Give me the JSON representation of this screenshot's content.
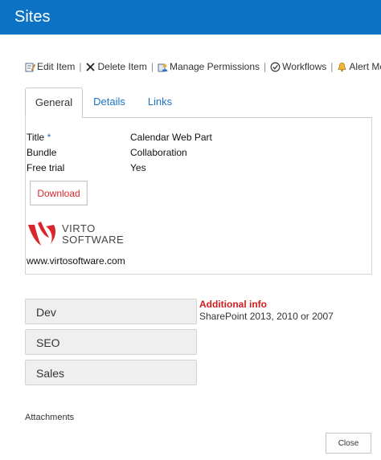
{
  "window": {
    "title": "Sites"
  },
  "toolbar": {
    "edit_item": "Edit Item",
    "delete_item": "Delete Item",
    "manage_permissions": "Manage Permissions",
    "workflows": "Workflows",
    "alert_me": "Alert Me",
    "separator": "|"
  },
  "tabs": [
    {
      "label": "General",
      "active": true
    },
    {
      "label": "Details",
      "active": false
    },
    {
      "label": "Links",
      "active": false
    }
  ],
  "fields": [
    {
      "label": "Title",
      "required_marker": " *",
      "value": "Calendar Web Part"
    },
    {
      "label": "Bundle",
      "value": "Collaboration"
    },
    {
      "label": "Free trial",
      "value": "Yes"
    }
  ],
  "download_label": "Download",
  "logo": {
    "line1": "VIRTO",
    "line2": "SOFTWARE",
    "url": "www.virtosoftware.com"
  },
  "accordion": [
    {
      "label": "Dev"
    },
    {
      "label": "SEO"
    },
    {
      "label": "Sales"
    }
  ],
  "additional_info": {
    "title": "Additional info",
    "text": "SharePoint 2013, 2010 or 2007"
  },
  "attachments_label": "Attachments",
  "close_label": "Close",
  "colors": {
    "brand_blue": "#0b72c5",
    "link_blue": "#1a73c8",
    "accent_red": "#d21c1c"
  },
  "icons": [
    "edit-icon",
    "delete-x-icon",
    "permissions-icon",
    "workflows-icon",
    "alert-icon"
  ]
}
